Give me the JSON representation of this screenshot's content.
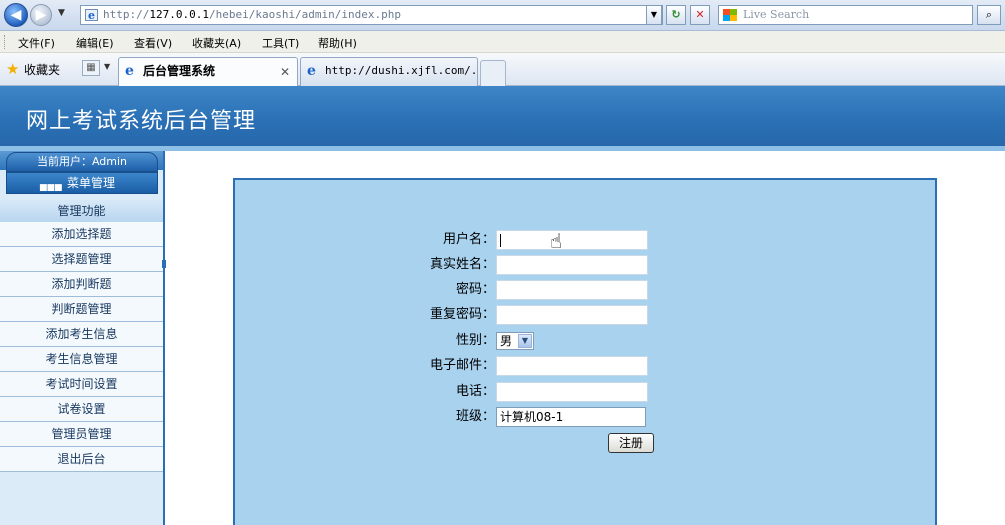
{
  "browser": {
    "url_prefix": "http://",
    "url_host": "127.0.0.1",
    "url_path": "/hebei/kaoshi/admin/index.php",
    "search_placeholder": "Live Search",
    "menu": [
      "文件(F)",
      "编辑(E)",
      "查看(V)",
      "收藏夹(A)",
      "工具(T)",
      "帮助(H)"
    ],
    "favorites_label": "收藏夹",
    "tabs": [
      {
        "label": "后台管理系统",
        "active": true
      },
      {
        "label": "http://dushi.xjfl.com/...",
        "active": false
      }
    ]
  },
  "header": {
    "title": "网上考试系统后台管理"
  },
  "sidebar": {
    "current_user": "当前用户：Admin",
    "menu_title": "菜单管理",
    "section_title": "管理功能",
    "items": [
      "添加选择题",
      "选择题管理",
      "添加判断题",
      "判断题管理",
      "添加考生信息",
      "考生信息管理",
      "考试时间设置",
      "试卷设置",
      "管理员管理",
      "退出后台"
    ]
  },
  "form": {
    "username_label": "用户名：",
    "username_value": "",
    "realname_label": "真实姓名：",
    "realname_value": "",
    "password_label": "密码：",
    "password_value": "",
    "confirm_label": "重复密码：",
    "confirm_value": "",
    "gender_label": "性别：",
    "gender_value": "男",
    "email_label": "电子邮件：",
    "email_value": "",
    "phone_label": "电话：",
    "phone_value": "",
    "class_label": "班级：",
    "class_value": "计算机08-1",
    "submit_label": "注册"
  }
}
